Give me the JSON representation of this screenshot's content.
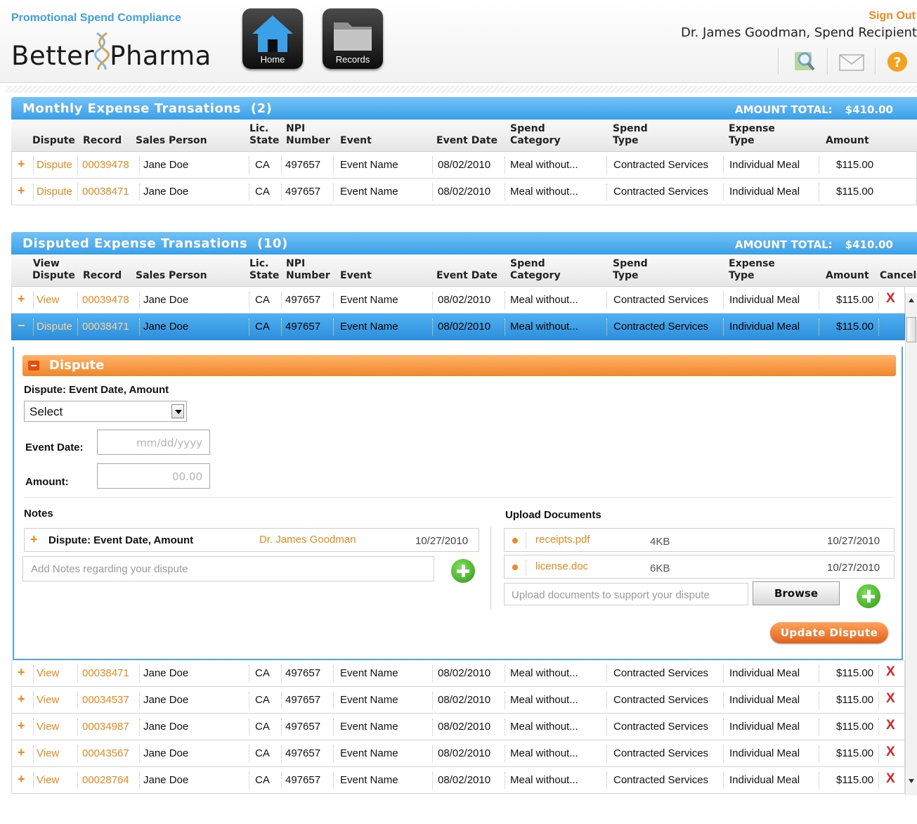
{
  "header": {
    "app_title": "Promotional Spend Compliance",
    "logo_left": "Better",
    "logo_right": "Pharma",
    "home_label": "Home",
    "records_label": "Records",
    "sign_out": "Sign Out",
    "user": "Dr. James Goodman, Spend Recipient"
  },
  "columns": {
    "dispute": "Dispute",
    "view": "View",
    "record": "Record",
    "sales_person": "Sales Person",
    "lic_1": "Lic.",
    "lic_2": "State",
    "npi_1": "NPI",
    "npi_2": "Number",
    "event": "Event",
    "event_date": "Event Date",
    "spend_cat_1": "Spend",
    "spend_cat_2": "Category",
    "spend_type_1": "Spend",
    "spend_type_2": "Type",
    "expense_type_1": "Expense",
    "expense_type_2": "Type",
    "amount": "Amount",
    "cancel": "Cancel"
  },
  "monthly": {
    "title": "Monthly Expense Transations",
    "count": "(2)",
    "total_label": "AMOUNT TOTAL:",
    "total_value": "$410.00",
    "rows": [
      {
        "action": "Dispute",
        "record": "00039478",
        "sales": "Jane Doe",
        "state": "CA",
        "npi": "497657",
        "event": "Event Name",
        "date": "08/02/2010",
        "category": "Meal without...",
        "spend_type": "Contracted Services",
        "expense_type": "Individual Meal",
        "amount": "$115.00"
      },
      {
        "action": "Dispute",
        "record": "00038471",
        "sales": "Jane Doe",
        "state": "CA",
        "npi": "497657",
        "event": "Event Name",
        "date": "08/02/2010",
        "category": "Meal without...",
        "spend_type": "Contracted Services",
        "expense_type": "Individual Meal",
        "amount": "$115.00"
      }
    ]
  },
  "disputed": {
    "title": "Disputed Expense Transations",
    "count": "(10)",
    "total_label": "AMOUNT TOTAL:",
    "total_value": "$410.00",
    "rows_top": [
      {
        "action": "View",
        "record": "00039478",
        "sales": "Jane Doe",
        "state": "CA",
        "npi": "497657",
        "event": "Event Name",
        "date": "08/02/2010",
        "category": "Meal without...",
        "spend_type": "Contracted Services",
        "expense_type": "Individual Meal",
        "amount": "$115.00",
        "cancel": "X"
      },
      {
        "action": "Dispute",
        "record": "00038471",
        "sales": "Jane Doe",
        "state": "CA",
        "npi": "497657",
        "event": "Event Name",
        "date": "08/02/2010",
        "category": "Meal without...",
        "spend_type": "Contracted Services",
        "expense_type": "Individual Meal",
        "amount": "$115.00",
        "cancel": ""
      }
    ],
    "rows_bottom": [
      {
        "action": "View",
        "record": "00038471",
        "sales": "Jane Doe",
        "state": "CA",
        "npi": "497657",
        "event": "Event Name",
        "date": "08/02/2010",
        "category": "Meal without...",
        "spend_type": "Contracted Services",
        "expense_type": "Individual Meal",
        "amount": "$115.00",
        "cancel": "X"
      },
      {
        "action": "View",
        "record": "00034537",
        "sales": "Jane Doe",
        "state": "CA",
        "npi": "497657",
        "event": "Event Name",
        "date": "08/02/2010",
        "category": "Meal without...",
        "spend_type": "Contracted Services",
        "expense_type": "Individual Meal",
        "amount": "$115.00",
        "cancel": "X"
      },
      {
        "action": "View",
        "record": "00034987",
        "sales": "Jane Doe",
        "state": "CA",
        "npi": "497657",
        "event": "Event Name",
        "date": "08/02/2010",
        "category": "Meal without...",
        "spend_type": "Contracted Services",
        "expense_type": "Individual Meal",
        "amount": "$115.00",
        "cancel": "X"
      },
      {
        "action": "View",
        "record": "00043567",
        "sales": "Jane Doe",
        "state": "CA",
        "npi": "497657",
        "event": "Event Name",
        "date": "08/02/2010",
        "category": "Meal without...",
        "spend_type": "Contracted Services",
        "expense_type": "Individual Meal",
        "amount": "$115.00",
        "cancel": "X"
      },
      {
        "action": "View",
        "record": "00028764",
        "sales": "Jane Doe",
        "state": "CA",
        "npi": "497657",
        "event": "Event Name",
        "date": "08/02/2010",
        "category": "Meal without...",
        "spend_type": "Contracted Services",
        "expense_type": "Individual Meal",
        "amount": "$115.00",
        "cancel": "X"
      }
    ]
  },
  "dispute_form": {
    "title": "Dispute",
    "dispute_label": "Dispute:",
    "dispute_value": "Event Date, Amount",
    "select_value": "Select",
    "event_date_label": "Event Date:",
    "event_date_placeholder": "mm/dd/yyyy",
    "amount_label": "Amount:",
    "amount_placeholder": "00.00",
    "notes_heading": "Notes",
    "note": {
      "title_label": "Dispute:",
      "title_value": "Event Date, Amount",
      "author": "Dr. James Goodman",
      "date": "10/27/2010"
    },
    "notes_placeholder": "Add Notes regarding your dispute",
    "upload_heading": "Upload Documents",
    "documents": [
      {
        "name": "receipts.pdf",
        "size": "4KB",
        "date": "10/27/2010"
      },
      {
        "name": "license.doc",
        "size": "6KB",
        "date": "10/27/2010"
      }
    ],
    "upload_placeholder": "Upload documents to support your dispute",
    "browse_label": "Browse",
    "update_label": "Update Dispute"
  },
  "colors": {
    "accent_blue": "#3aa0e8",
    "accent_orange": "#f0891e",
    "cancel_red": "#e01f1f",
    "add_green": "#2d9a12"
  }
}
